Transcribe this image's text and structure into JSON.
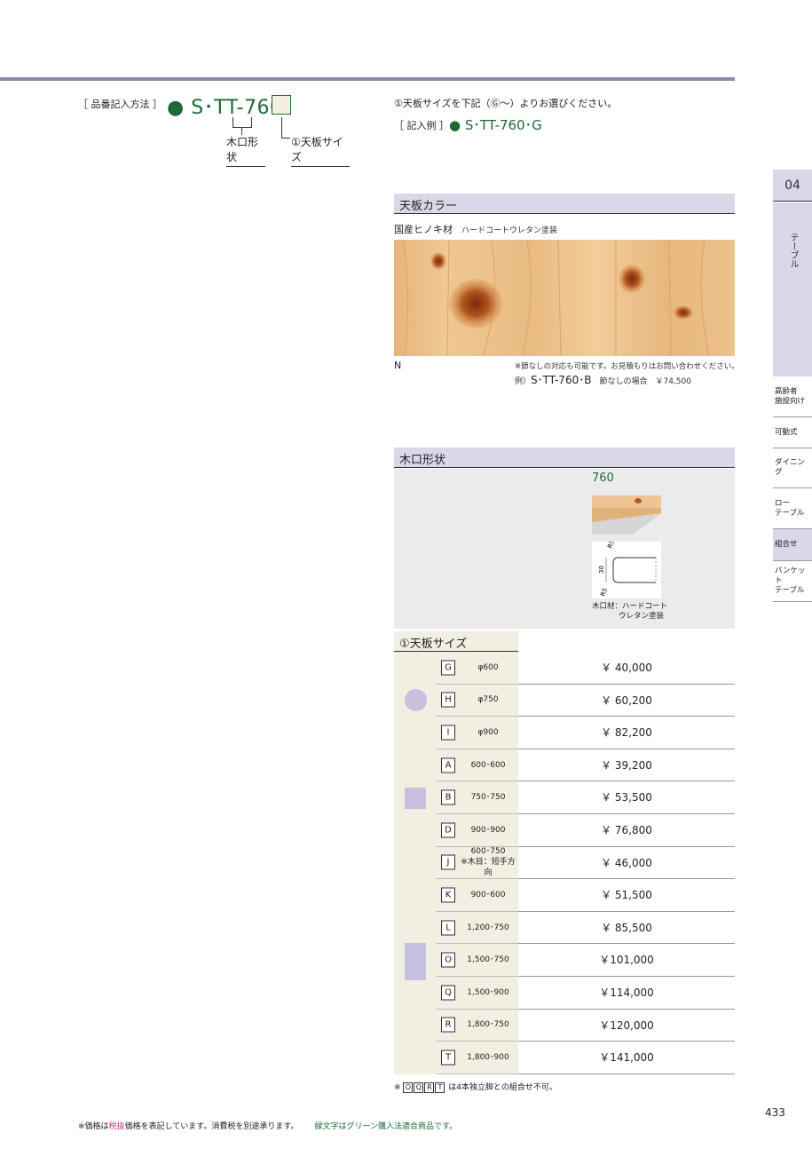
{
  "order": {
    "label": "［ 品番記入方法 ］",
    "code": "● S･TT-760･",
    "shape_caption": "木口形状",
    "size_caption": "①天板サイズ"
  },
  "instructions": {
    "select_note": "①天板サイズを下記（Ⓖ～）よりお選びください。",
    "example_label": "［ 記入例 ］",
    "example_code": "● S･TT-760･G"
  },
  "top_color": {
    "header": "天板カラー",
    "material": "国産ヒノキ材",
    "finish": "ハードコートウレタン塗装",
    "swatch_code": "N",
    "knot_note": "※節なしの対応も可能です。お見積もりはお問い合わせください。",
    "example_prefix": "例）",
    "example_code": "S･TT-760･B",
    "example_suffix": "節なしの場合　￥74,500"
  },
  "edge_shape": {
    "header": "木口形状",
    "size": "760",
    "drawing_labels": [
      "R5",
      "30",
      "R5"
    ],
    "material_line1": "木口材：ハードコート",
    "material_line2": "ウレタン塗装"
  },
  "size_table": {
    "header": "①天板サイズ",
    "groups": [
      {
        "shape": "circle",
        "rows": [
          {
            "code": "G",
            "dim": "φ600",
            "price": "￥ 40,000"
          },
          {
            "code": "H",
            "dim": "φ750",
            "price": "￥ 60,200"
          },
          {
            "code": "I",
            "dim": "φ900",
            "price": "￥ 82,200"
          }
        ]
      },
      {
        "shape": "square",
        "rows": [
          {
            "code": "A",
            "dim": "600･600",
            "price": "￥ 39,200"
          },
          {
            "code": "B",
            "dim": "750･750",
            "price": "￥ 53,500"
          },
          {
            "code": "D",
            "dim": "900･900",
            "price": "￥ 76,800"
          }
        ]
      },
      {
        "shape": "rect",
        "rows": [
          {
            "code": "J",
            "dim": "600･750",
            "dim2": "※木目：短手方向",
            "price": "￥ 46,000"
          },
          {
            "code": "K",
            "dim": "900･600",
            "price": "￥ 51,500"
          },
          {
            "code": "L",
            "dim": "1,200･750",
            "price": "￥ 85,500"
          },
          {
            "code": "O",
            "dim": "1,500･750",
            "price": "￥101,000"
          },
          {
            "code": "Q",
            "dim": "1,500･900",
            "price": "￥114,000"
          },
          {
            "code": "R",
            "dim": "1,800･750",
            "price": "￥120,000"
          },
          {
            "code": "T",
            "dim": "1,800･900",
            "price": "￥141,000"
          }
        ]
      }
    ],
    "foot_prefix": "※",
    "foot_codes": [
      "O",
      "Q",
      "R",
      "T"
    ],
    "foot_text": "は4本独立脚との組合せ不可。"
  },
  "side_nav": {
    "chapter": "04",
    "chapter_label": "テーブル",
    "items": [
      {
        "label": "高齢者\n施設向け",
        "active": false
      },
      {
        "label": "可動式",
        "active": false
      },
      {
        "label": "ダイニング",
        "active": false
      },
      {
        "label": "ロー\nテーブル",
        "active": false
      },
      {
        "label": "組合せ",
        "active": true
      },
      {
        "label": "バンケット\nテーブル",
        "active": false
      }
    ]
  },
  "footer": {
    "note_pre": "※価格は",
    "note_red": "税抜",
    "note_post": "価格を表記しています。消費税を別途承ります。",
    "note_green": "緑文字はグリーン購入法適合商品です。",
    "page_number": "433"
  },
  "colors": {
    "accent_green": "#1d6a36",
    "header_lavender": "#d9d7e8",
    "table_beige": "#f2eee1",
    "shape_purple": "#c7c1e0"
  }
}
